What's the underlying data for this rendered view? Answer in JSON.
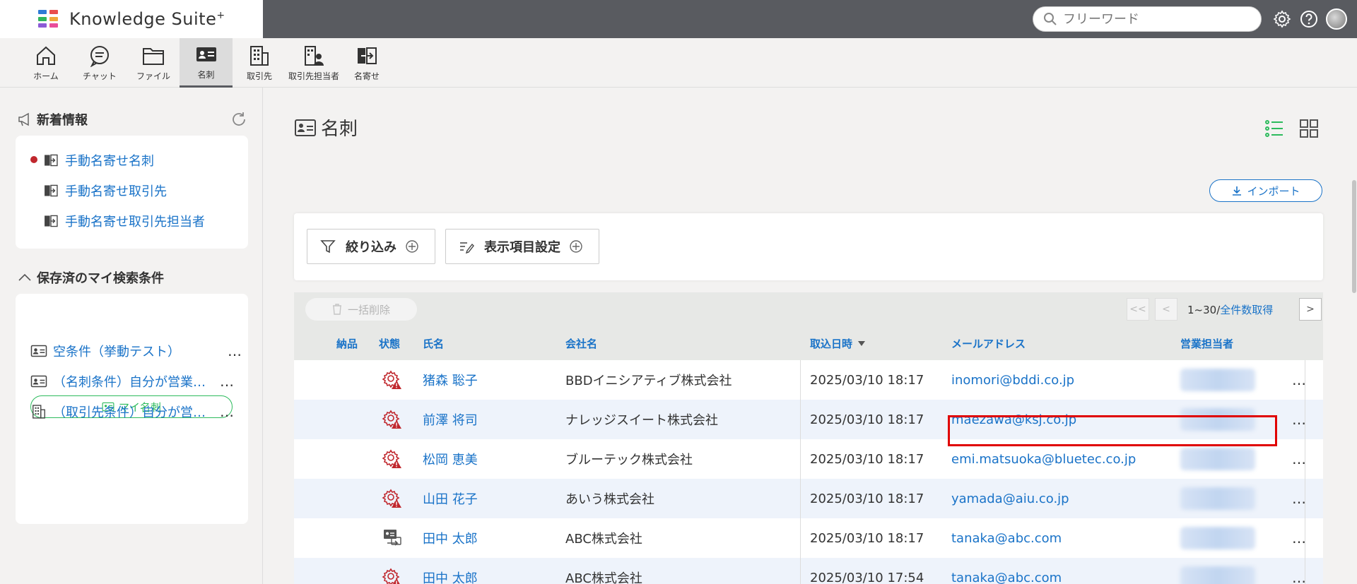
{
  "app": {
    "name": "Knowledge Suite",
    "name_suffix": "+",
    "logo_colors": [
      "#2e7bd6",
      "#e94d4d",
      "#2fb65c",
      "#f0a73a",
      "#8c5bd6",
      "#e94d9a"
    ]
  },
  "header": {
    "search_placeholder": "フリーワード",
    "icons": [
      "gear-icon",
      "help-icon",
      "avatar"
    ]
  },
  "nav": {
    "items": [
      {
        "label": "ホーム",
        "icon": "home-icon"
      },
      {
        "label": "チャット",
        "icon": "chat-icon"
      },
      {
        "label": "ファイル",
        "icon": "folder-icon"
      },
      {
        "label": "名刺",
        "icon": "business-card-icon",
        "active": true
      },
      {
        "label": "取引先",
        "icon": "building-icon"
      },
      {
        "label": "取引先担当者",
        "icon": "contact-person-icon"
      },
      {
        "label": "名寄せ",
        "icon": "merge-icon"
      }
    ]
  },
  "sidebar": {
    "news": {
      "title": "新着情報",
      "items": [
        {
          "label": "手動名寄せ名刺",
          "unread": true
        },
        {
          "label": "手動名寄せ取引先",
          "unread": false
        },
        {
          "label": "手動名寄せ取引先担当者",
          "unread": false
        }
      ]
    },
    "saved": {
      "title": "保存済のマイ検索条件",
      "my_card_button": "マイ名刺",
      "items": [
        {
          "label": "空条件（挙動テスト）",
          "icon": "business-card-icon"
        },
        {
          "label": "（名刺条件）自分が営業担当者の名刺",
          "icon": "business-card-icon"
        },
        {
          "label": "（取引先条件）自分が営業担当者の取引先",
          "icon": "building-icon"
        }
      ],
      "more": "…"
    }
  },
  "main": {
    "title": "名刺",
    "import_label": "インポート",
    "filter_label": "絞り込み",
    "columns_setting_label": "表示項目設定",
    "bulk_delete_label": "一括削除",
    "pager": {
      "range": "1~30",
      "sep": "/",
      "total_link": "全件数取得"
    },
    "table": {
      "headers": {
        "delivered": "納品",
        "status": "状態",
        "name": "氏名",
        "company": "会社名",
        "imported_at": "取込日時",
        "email": "メールアドレス",
        "sales_rep": "営業担当者"
      },
      "rows": [
        {
          "status": "warning",
          "name": "猪森 聡子",
          "company": "BBDイニシアティブ株式会社",
          "imported_at": "2025/03/10 18:17",
          "email": "inomori@bddi.co.jp"
        },
        {
          "status": "warning",
          "name": "前澤 将司",
          "company": "ナレッジスイート株式会社",
          "imported_at": "2025/03/10 18:17",
          "email": "maezawa@ksj.co.jp"
        },
        {
          "status": "warning",
          "name": "松岡 恵美",
          "company": "ブルーテック株式会社",
          "imported_at": "2025/03/10 18:17",
          "email": "emi.matsuoka@bluetec.co.jp"
        },
        {
          "status": "warning",
          "name": "山田 花子",
          "company": "あいう株式会社",
          "imported_at": "2025/03/10 18:17",
          "email": "yamada@aiu.co.jp"
        },
        {
          "status": "merged",
          "name": "田中 太郎",
          "company": "ABC株式会社",
          "imported_at": "2025/03/10 18:17",
          "email": "tanaka@abc.com"
        },
        {
          "status": "warning",
          "name": "田中 太郎",
          "company": "ABC株式会社",
          "imported_at": "2025/03/10 17:54",
          "email": "tanaka@abc.com"
        }
      ],
      "row_more": "…"
    }
  },
  "colors": {
    "accent": "#1a73c8",
    "header_bg": "#595b60",
    "highlight": "#e00000",
    "warning_red": "#c0272d",
    "green": "#2dbb5d"
  }
}
